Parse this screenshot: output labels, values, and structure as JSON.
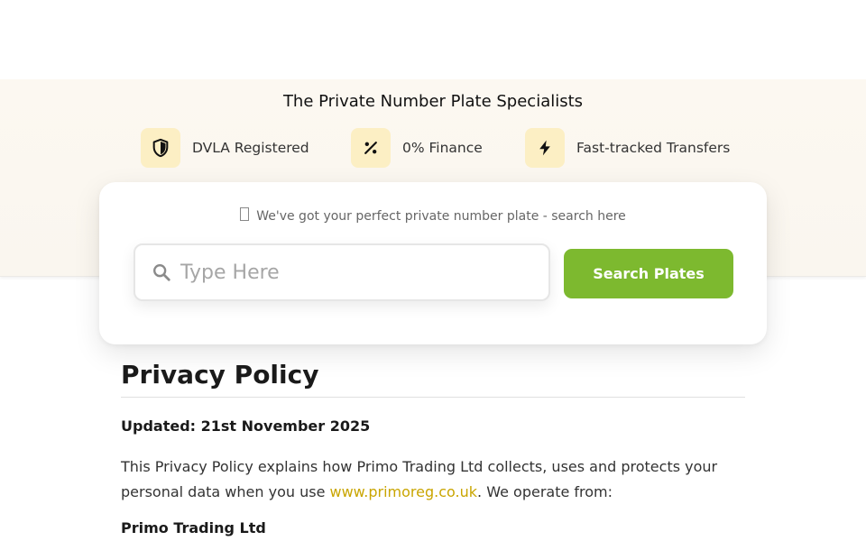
{
  "hero": {
    "tagline": "The Private Number Plate Specialists",
    "features": [
      {
        "icon": "shield-icon",
        "label": "DVLA Registered"
      },
      {
        "icon": "percent-icon",
        "label": "0% Finance"
      },
      {
        "icon": "lightning-icon",
        "label": "Fast-tracked Transfers"
      }
    ],
    "icon_bg": "#fcefc4"
  },
  "search": {
    "note": "We've got your perfect private number plate - search here",
    "placeholder": "Type Here",
    "value": "",
    "button_label": "Search Plates",
    "button_color": "#7db92f"
  },
  "content": {
    "title": "Privacy Policy",
    "updated": "Updated: 21st November 2025",
    "intro_before": "This Privacy Policy explains how Primo Trading Ltd collects, uses and protects your personal data when you use ",
    "intro_link": "www.primoreg.co.uk",
    "intro_after": ". We operate from:",
    "company": "Primo Trading Ltd",
    "link_color": "#c9a500"
  }
}
